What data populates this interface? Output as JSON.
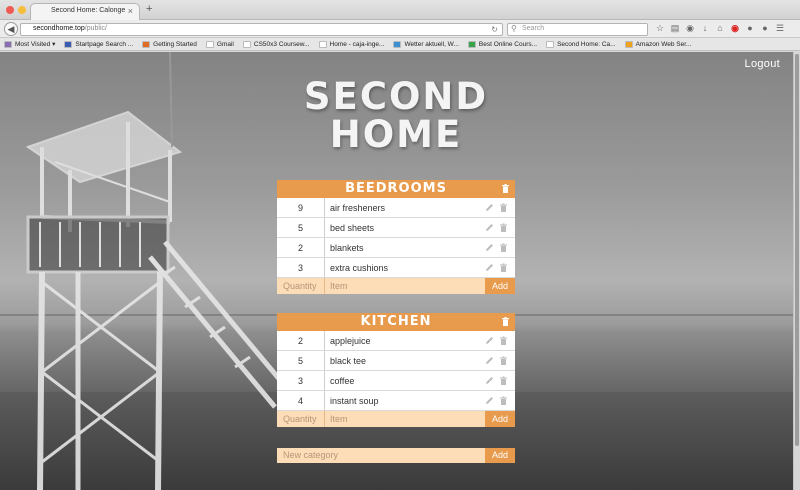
{
  "browser": {
    "tab_title": "Second Home: Calonge",
    "tab_close": "×",
    "new_tab": "+",
    "url_host": "secondhome.top",
    "url_path": "/public/",
    "search_placeholder": "Search",
    "bookmarks": [
      {
        "label": "Most Visited ▾",
        "color": "#8b6db3"
      },
      {
        "label": "Startpage Search ...",
        "color": "#3a5db3"
      },
      {
        "label": "Getting Started",
        "color": "#e06b24"
      },
      {
        "label": "Gmail",
        "color": "#ffffff"
      },
      {
        "label": "CS50x3 Coursew...",
        "color": "#ffffff"
      },
      {
        "label": "Home - caja-inge...",
        "color": "#ffffff"
      },
      {
        "label": "Wetter aktuell, W...",
        "color": "#3e8fd0"
      },
      {
        "label": "Best Online Cours...",
        "color": "#3aa34a"
      },
      {
        "label": "Second Home: Ca...",
        "color": "#ffffff"
      },
      {
        "label": "Amazon Web Ser...",
        "color": "#f0a21f"
      }
    ]
  },
  "page": {
    "logout_label": "Logout",
    "brand_line1": "SECOND",
    "brand_line2": "HOME"
  },
  "categories": [
    {
      "name": "BEEDROOMS",
      "items": [
        {
          "qty": "9",
          "name": "air fresheners"
        },
        {
          "qty": "5",
          "name": "bed sheets"
        },
        {
          "qty": "2",
          "name": "blankets"
        },
        {
          "qty": "3",
          "name": "extra cushions"
        }
      ],
      "qty_placeholder": "Quantity",
      "item_placeholder": "Item",
      "add_label": "Add"
    },
    {
      "name": "KITCHEN",
      "items": [
        {
          "qty": "2",
          "name": "applejuice"
        },
        {
          "qty": "5",
          "name": "black tee"
        },
        {
          "qty": "3",
          "name": "coffee"
        },
        {
          "qty": "4",
          "name": "instant soup"
        }
      ],
      "qty_placeholder": "Quantity",
      "item_placeholder": "Item",
      "add_label": "Add"
    }
  ],
  "new_category": {
    "placeholder": "New category",
    "add_label": "Add"
  },
  "colors": {
    "accent": "#e89b4c",
    "input_bg": "#fddcb8"
  }
}
